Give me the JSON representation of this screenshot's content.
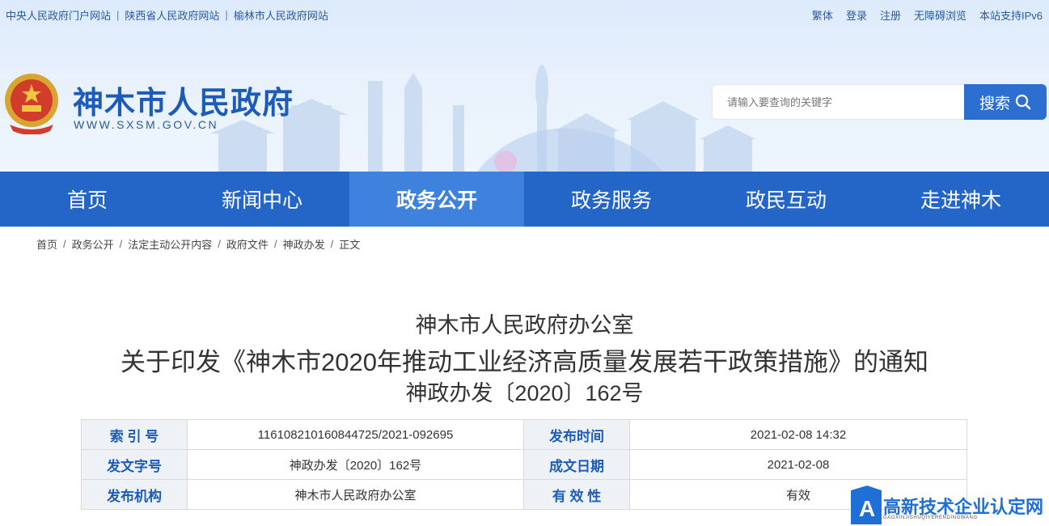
{
  "topbar": {
    "left_links": [
      "中央人民政府门户网站",
      "陕西省人民政府网站",
      "榆林市人民政府网站"
    ],
    "separator": "|",
    "right_links": [
      "繁体",
      "登录",
      "注册",
      "无障碍浏览",
      "本站支持IPv6"
    ]
  },
  "site": {
    "title": "神木市人民政府",
    "url": "WWW.SXSM.GOV.CN"
  },
  "search": {
    "placeholder": "请输入要查询的关键字",
    "button_label": "搜索"
  },
  "nav": {
    "items": [
      "首页",
      "新闻中心",
      "政务公开",
      "政务服务",
      "政民互动",
      "走进神木"
    ],
    "active": "政务公开"
  },
  "breadcrumb": {
    "items": [
      "首页",
      "政务公开",
      "法定主动公开内容",
      "政府文件",
      "神政办发",
      "正文"
    ],
    "separator": "/"
  },
  "article": {
    "org": "神木市人民政府办公室",
    "title": "关于印发《神木市2020年推动工业经济高质量发展若干政策措施》的通知",
    "doc_no": "神政办发〔2020〕162号"
  },
  "meta": {
    "rows": [
      {
        "k1": "索 引 号",
        "v1": "11610821016084472​5/2021-092695",
        "k2": "发布时间",
        "v2": "2021-02-08 14:32"
      },
      {
        "k1": "发文字号",
        "v1": "神政办发〔2020〕162号",
        "k2": "成文日期",
        "v2": "2021-02-08"
      },
      {
        "k1": "发布机构",
        "v1": "神木市人民政府办公室",
        "k2": "有 效 性",
        "v2": "有效"
      }
    ]
  },
  "watermark": {
    "text": "高新技术企业认定网",
    "subtext": "GAOXINJISHUQIYERENDINGWANG",
    "logo_letter": "A"
  },
  "colors": {
    "brand_blue": "#1c5cb8",
    "nav_blue": "#2466c8",
    "nav_active": "#3f82de"
  }
}
